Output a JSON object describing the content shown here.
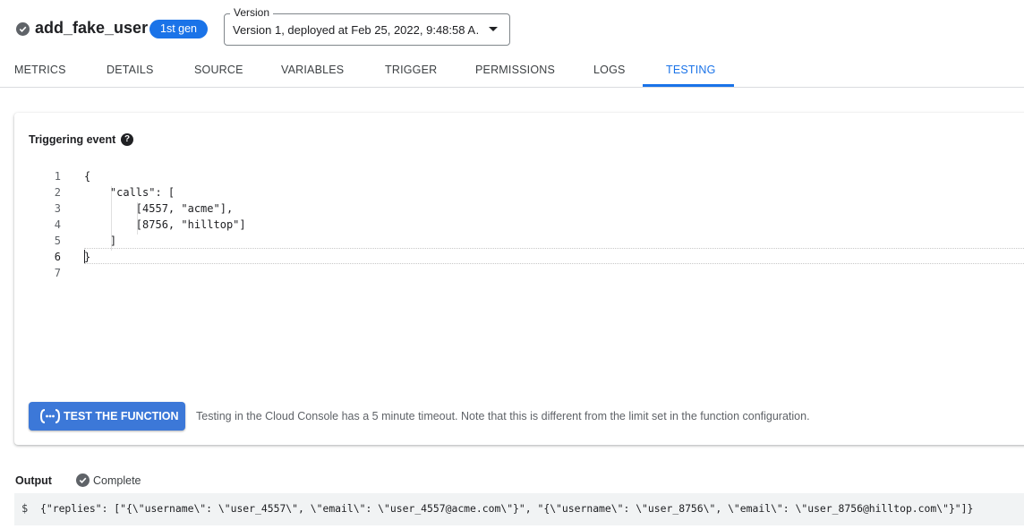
{
  "header": {
    "function_name": "add_fake_user",
    "gen_badge": "1st gen",
    "version_label": "Version",
    "version_value": "Version 1, deployed at Feb 25, 2022, 9:48:58 A…"
  },
  "tabs": [
    {
      "label": "METRICS",
      "active": false
    },
    {
      "label": "DETAILS",
      "active": false
    },
    {
      "label": "SOURCE",
      "active": false
    },
    {
      "label": "VARIABLES",
      "active": false
    },
    {
      "label": "TRIGGER",
      "active": false
    },
    {
      "label": "PERMISSIONS",
      "active": false
    },
    {
      "label": "LOGS",
      "active": false
    },
    {
      "label": "TESTING",
      "active": true
    }
  ],
  "testing": {
    "triggering_event_label": "Triggering event",
    "help_icon": "?",
    "line_numbers": [
      "1",
      "2",
      "3",
      "4",
      "5",
      "6",
      "7"
    ],
    "code_lines": [
      "{",
      "    \"calls\": [",
      "        [4557, \"acme\"],",
      "        [8756, \"hilltop\"]",
      "    ]",
      "}",
      ""
    ],
    "test_button_label": "TEST THE FUNCTION",
    "test_note": "Testing in the Cloud Console has a 5 minute timeout. Note that this is different from the limit set in the function configuration."
  },
  "output": {
    "label": "Output",
    "status": "Complete",
    "prompt": "$",
    "text": "{\"replies\": [\"{\\\"username\\\": \\\"user_4557\\\", \\\"email\\\": \\\"user_4557@acme.com\\\"}\", \"{\\\"username\\\": \\\"user_8756\\\", \\\"email\\\": \\\"user_8756@hilltop.com\\\"}\"]}"
  },
  "colors": {
    "accent": "#1a73e8",
    "button": "#3c78d8",
    "status_icon": "#5f6368"
  },
  "icons": {
    "status": "check-circle-icon",
    "help": "help-icon",
    "function": "function-icon",
    "caret": "caret-down-icon",
    "complete": "check-circle-icon"
  }
}
